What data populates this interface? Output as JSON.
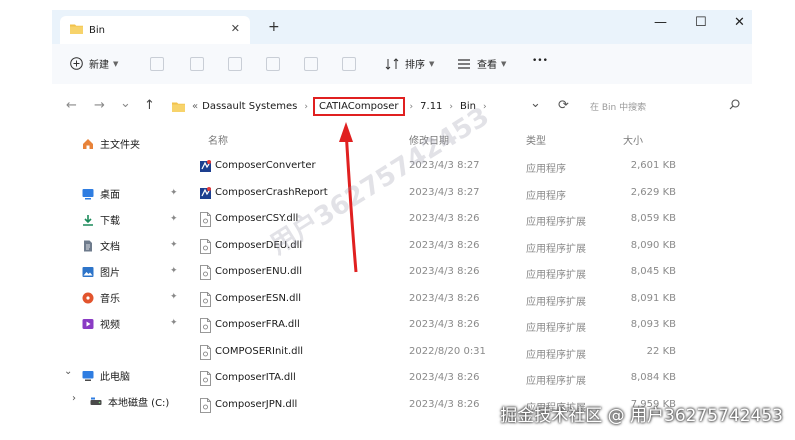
{
  "window": {
    "tab_title": "Bin",
    "tab_close": "✕",
    "new_tab": "+",
    "controls": {
      "minimize": "—",
      "maximize": "☐",
      "close": "✕"
    }
  },
  "toolbar": {
    "new_label": "新建",
    "sort_label": "排序",
    "view_label": "查看",
    "more_label": "•••"
  },
  "address": {
    "back": "←",
    "forward": "→",
    "history": "⌄",
    "up": "↑",
    "crumbs": [
      "«",
      "Dassault Systemes",
      "CATIAComposer",
      "7.11",
      "Bin"
    ],
    "dropdown": "⌄",
    "refresh": "⟳",
    "search_placeholder": "在 Bin 中搜索"
  },
  "sidebar": {
    "items": [
      {
        "label": "主文件夹",
        "icon": "home-icon",
        "color": "#e8833a"
      },
      {
        "label": "桌面",
        "icon": "desktop-icon",
        "color": "#2f7de1"
      },
      {
        "label": "下载",
        "icon": "download-icon",
        "color": "#1b8a5a"
      },
      {
        "label": "文档",
        "icon": "document-icon",
        "color": "#5f6b7a"
      },
      {
        "label": "图片",
        "icon": "picture-icon",
        "color": "#2d74c9"
      },
      {
        "label": "音乐",
        "icon": "music-icon",
        "color": "#e2542d"
      },
      {
        "label": "视频",
        "icon": "video-icon",
        "color": "#8a3bc4"
      },
      {
        "label": "此电脑",
        "icon": "pc-icon",
        "color": "#2f7de1"
      },
      {
        "label": "本地磁盘 (C:)",
        "icon": "drive-icon",
        "color": "#4a4a4a"
      }
    ],
    "pin": "📌",
    "expand_open": "⌄",
    "expand_closed": "›"
  },
  "columns": {
    "name": "名称",
    "date": "修改日期",
    "type": "类型",
    "size": "大小"
  },
  "files": [
    {
      "name": "ComposerConverter",
      "date": "2023/4/3 8:27",
      "type": "应用程序",
      "size": "2,601 KB",
      "kind": "exe"
    },
    {
      "name": "ComposerCrashReport",
      "date": "2023/4/3 8:27",
      "type": "应用程序",
      "size": "2,629 KB",
      "kind": "exe"
    },
    {
      "name": "ComposerCSY.dll",
      "date": "2023/4/3 8:26",
      "type": "应用程序扩展",
      "size": "8,059 KB",
      "kind": "dll"
    },
    {
      "name": "ComposerDEU.dll",
      "date": "2023/4/3 8:26",
      "type": "应用程序扩展",
      "size": "8,090 KB",
      "kind": "dll"
    },
    {
      "name": "ComposerENU.dll",
      "date": "2023/4/3 8:26",
      "type": "应用程序扩展",
      "size": "8,045 KB",
      "kind": "dll"
    },
    {
      "name": "ComposerESN.dll",
      "date": "2023/4/3 8:26",
      "type": "应用程序扩展",
      "size": "8,091 KB",
      "kind": "dll"
    },
    {
      "name": "ComposerFRA.dll",
      "date": "2023/4/3 8:26",
      "type": "应用程序扩展",
      "size": "8,093 KB",
      "kind": "dll"
    },
    {
      "name": "COMPOSERInit.dll",
      "date": "2022/8/20 0:31",
      "type": "应用程序扩展",
      "size": "22 KB",
      "kind": "dll"
    },
    {
      "name": "ComposerITA.dll",
      "date": "2023/4/3 8:26",
      "type": "应用程序扩展",
      "size": "8,084 KB",
      "kind": "dll"
    },
    {
      "name": "ComposerJPN.dll",
      "date": "2023/4/3 8:26",
      "type": "应用程序扩展",
      "size": "7,959 KB",
      "kind": "dll"
    }
  ],
  "annotation": {
    "color": "#e02020"
  },
  "watermark": "用户3627574245З",
  "footer_watermark": "掘金技术社区 @ 用户36275742453"
}
